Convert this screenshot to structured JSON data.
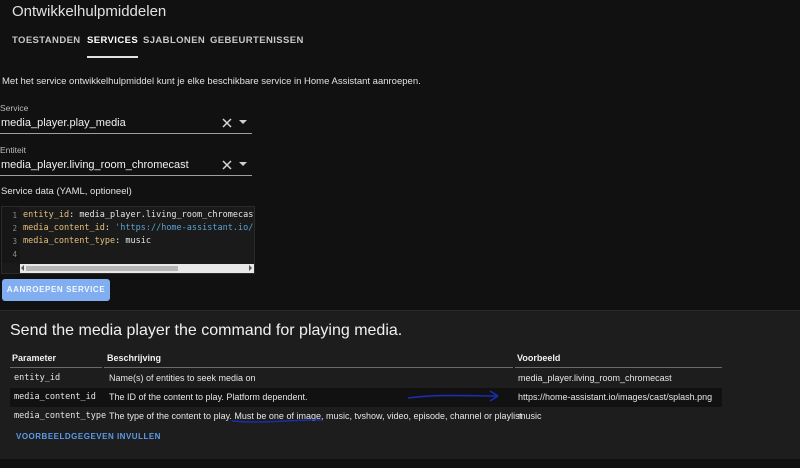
{
  "app": {
    "title": "Ontwikkelhulpmiddelen"
  },
  "tabs": [
    {
      "label": "TOESTANDEN",
      "active": false
    },
    {
      "label": "SERVICES",
      "active": true
    },
    {
      "label": "SJABLONEN",
      "active": false
    },
    {
      "label": "GEBEURTENISSEN",
      "active": false
    }
  ],
  "intro": "Met het service ontwikkelhulpmiddel kunt je elke beschikbare service in Home Assistant aanroepen.",
  "service_field": {
    "label": "Service",
    "value": "media_player.play_media"
  },
  "entity_field": {
    "label": "Entiteit",
    "value": "media_player.living_room_chromecast"
  },
  "service_data": {
    "label": "Service data (YAML, optioneel)",
    "lines": [
      {
        "num": "1",
        "key": "entity_id",
        "value": "media_player.living_room_chromecast",
        "string": false
      },
      {
        "num": "2",
        "key": "media_content_id",
        "value": "'https://home-assistant.io/ima",
        "string": true
      },
      {
        "num": "3",
        "key": "media_content_type",
        "value": "music",
        "string": false
      },
      {
        "num": "4",
        "key": "",
        "value": "",
        "string": false
      }
    ]
  },
  "call_button": {
    "label": "AANROEPEN SERVICE"
  },
  "service_info": {
    "title": "Send the media player the command for playing media.",
    "columns": [
      "Parameter",
      "Beschrijving",
      "Voorbeeld"
    ],
    "rows": [
      {
        "param": "entity_id",
        "desc": "Name(s) of entities to seek media on",
        "example": "media_player.living_room_chromecast"
      },
      {
        "param": "media_content_id",
        "desc": "The ID of the content to play. Platform dependent.",
        "example": "https://home-assistant.io/images/cast/splash.png"
      },
      {
        "param": "media_content_type",
        "desc": "The type of the content to play. Must be one of image, music, tvshow, video, episode, channel or playlist",
        "example": "music"
      }
    ],
    "fill_link": "VOORBEELDGEGEVEN INVULLEN"
  },
  "colors": {
    "accent": "#80aef0",
    "link": "#5b9ae8",
    "annotation": "#1a2fb0"
  },
  "icons": {
    "clear": "close-icon",
    "dropdown": "menu-down-icon"
  }
}
